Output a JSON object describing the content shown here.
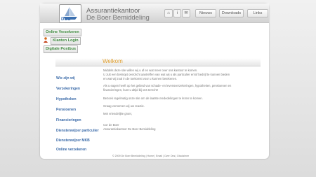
{
  "header": {
    "title_line1": "Assurantiekantoor",
    "title_line2": "De Boer Bemiddeling",
    "logo_text": "DBB",
    "nav": {
      "home_icon": "home-icon",
      "info_label": "i",
      "contact_label": "✉",
      "nieuws": "Nieuws",
      "downloads": "Downloads",
      "links": "Links"
    }
  },
  "sidebar": {
    "online_verzekeren": "Online Verzekeren",
    "klanten_login": "Klanten Login",
    "digitale_postbus": "Digitale Postbus"
  },
  "welcome": "Welkom",
  "menu": [
    "Wie zijn wij",
    "Verzekeringen",
    "Hypotheken",
    "Pensioenen",
    "Financieringen",
    "Dienstenwijzer particulier",
    "Dienstenwijzer MKB",
    "Online verzekeren"
  ],
  "paragraphs": [
    "Middels deze site willen wij u af en wat meer over ons kantoor te komen.",
    "U zult een beknopt overzicht aantreffen van wat wij u als particulier en/of bedrijf te kunnen bieden",
    "en wat wij zoal in de toekomst voor u kunnen betekenen.",
    "Als u eagen heeft op het gebied van schade- en levensverzekeringen, hypotheken, pensioenen en",
    "financieringen, kunt u altijd bij ons terecht!",
    "Bezoek regelmatig onze site om de laatste mededelingen te lezen te komen.",
    "Graag vernemen wij uw reactie.",
    "Met vriendelijke groet,",
    "Cor de Boer",
    "Assurantiekantoor De Boer Bemiddeling"
  ],
  "footer": "© 2009 De Boer Bemiddeling  |  Home  |  Email  |  Over Ons  |  Disclaimer"
}
